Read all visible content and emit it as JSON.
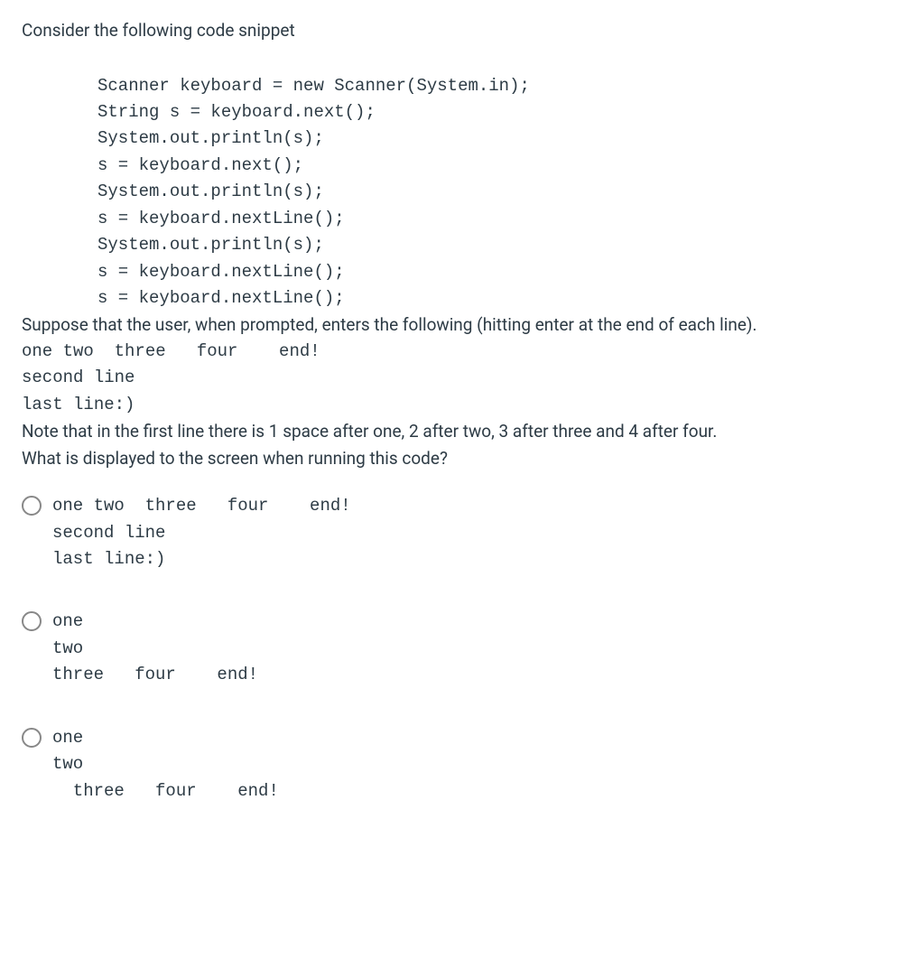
{
  "intro": "Consider the following code snippet",
  "code": "Scanner keyboard = new Scanner(System.in);\nString s = keyboard.next();\nSystem.out.println(s);\ns = keyboard.next();\nSystem.out.println(s);\ns = keyboard.nextLine();\nSystem.out.println(s);\ns = keyboard.nextLine();\ns = keyboard.nextLine();",
  "prose1": "Suppose that the user, when prompted, enters the following (hitting enter at the end of each line).",
  "input": "one two  three   four    end!\nsecond line\nlast line:)",
  "prose2": "Note that in the first line there is 1 space after one, 2 after two, 3 after three and 4 after four.",
  "prose3": "What is displayed to the screen when running this code?",
  "options": [
    "one two  three   four    end!\nsecond line\nlast line:)",
    "one\ntwo\nthree   four    end!",
    "one\ntwo\n  three   four    end!"
  ]
}
